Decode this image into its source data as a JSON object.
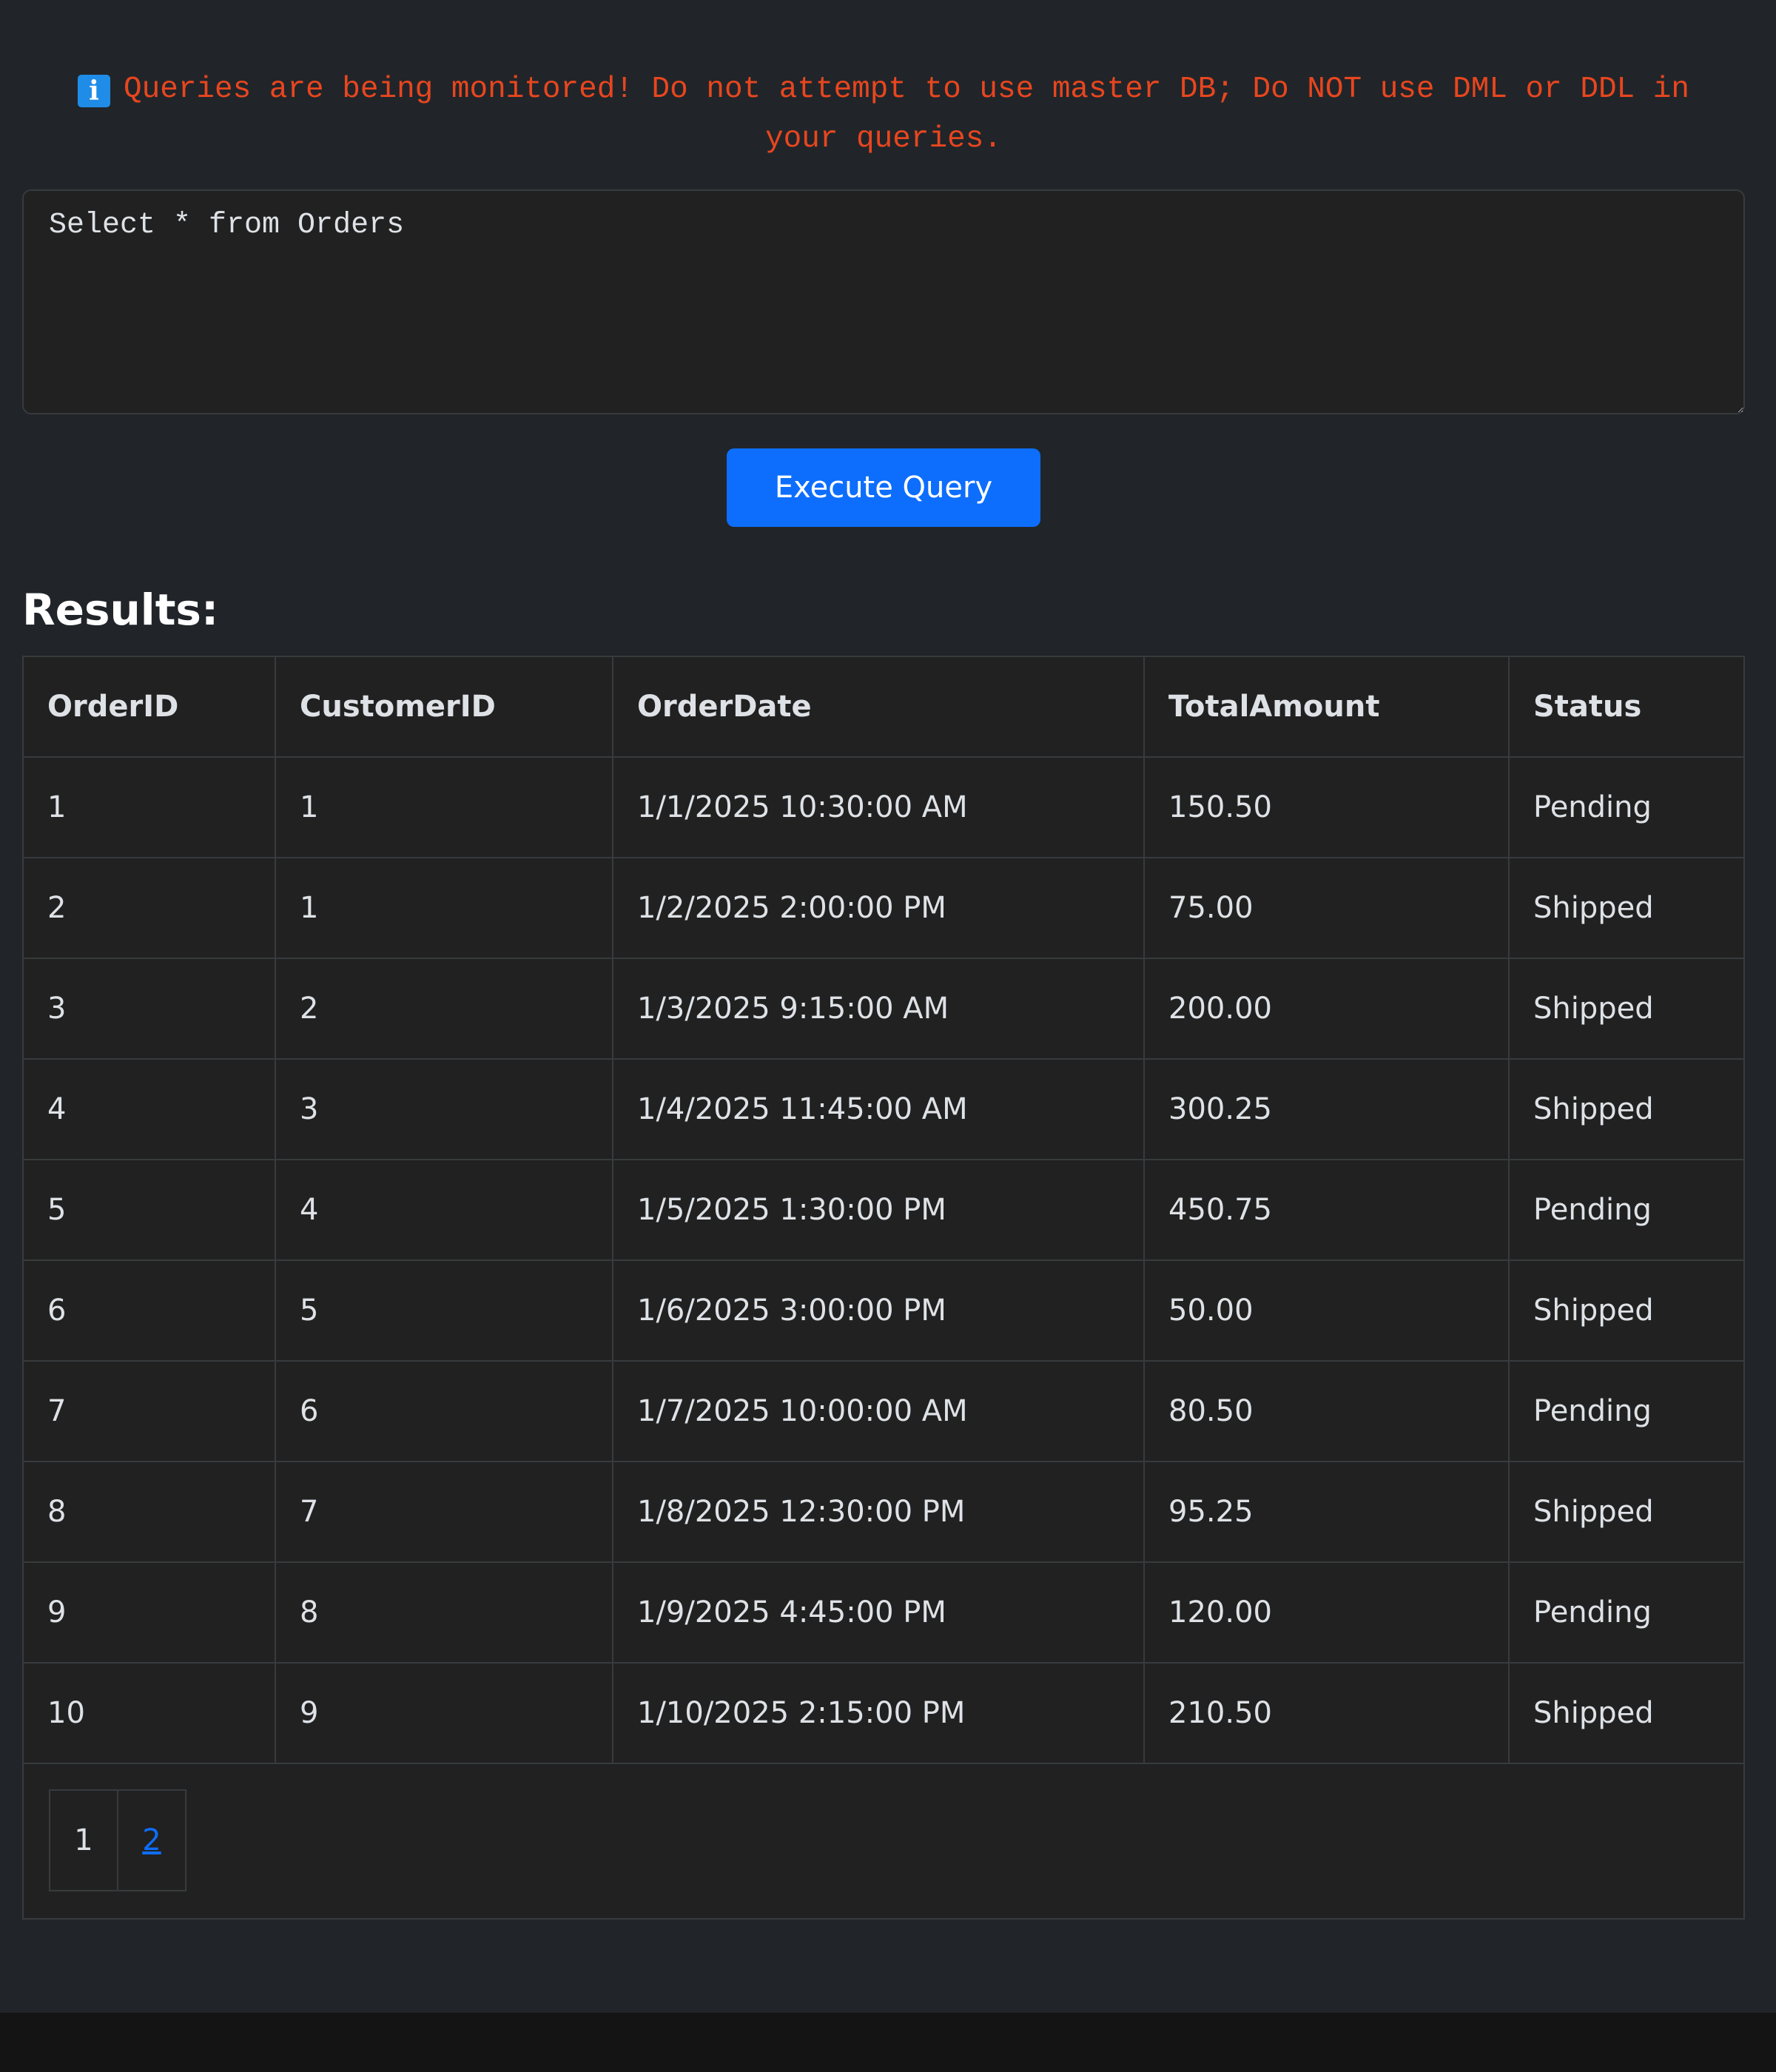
{
  "warning": {
    "icon": "info-icon",
    "text": "Queries are being monitored! Do not attempt to use master DB; Do NOT use DML or DDL in your queries."
  },
  "query": {
    "value": "Select * from Orders"
  },
  "execute_button": {
    "label": "Execute Query"
  },
  "results": {
    "title": "Results:",
    "columns": [
      "OrderID",
      "CustomerID",
      "OrderDate",
      "TotalAmount",
      "Status"
    ],
    "rows": [
      [
        "1",
        "1",
        "1/1/2025 10:30:00 AM",
        "150.50",
        "Pending"
      ],
      [
        "2",
        "1",
        "1/2/2025 2:00:00 PM",
        "75.00",
        "Shipped"
      ],
      [
        "3",
        "2",
        "1/3/2025 9:15:00 AM",
        "200.00",
        "Shipped"
      ],
      [
        "4",
        "3",
        "1/4/2025 11:45:00 AM",
        "300.25",
        "Shipped"
      ],
      [
        "5",
        "4",
        "1/5/2025 1:30:00 PM",
        "450.75",
        "Pending"
      ],
      [
        "6",
        "5",
        "1/6/2025 3:00:00 PM",
        "50.00",
        "Shipped"
      ],
      [
        "7",
        "6",
        "1/7/2025 10:00:00 AM",
        "80.50",
        "Pending"
      ],
      [
        "8",
        "7",
        "1/8/2025 12:30:00 PM",
        "95.25",
        "Shipped"
      ],
      [
        "9",
        "8",
        "1/9/2025 4:45:00 PM",
        "120.00",
        "Pending"
      ],
      [
        "10",
        "9",
        "1/10/2025 2:15:00 PM",
        "210.50",
        "Shipped"
      ]
    ]
  },
  "pagination": {
    "current": "1",
    "other_page": "2"
  },
  "colors": {
    "background": "#212529",
    "warning_text": "#e8461f",
    "info_icon": "#1f8de8",
    "button": "#0d6efd",
    "link": "#0d6efd"
  }
}
